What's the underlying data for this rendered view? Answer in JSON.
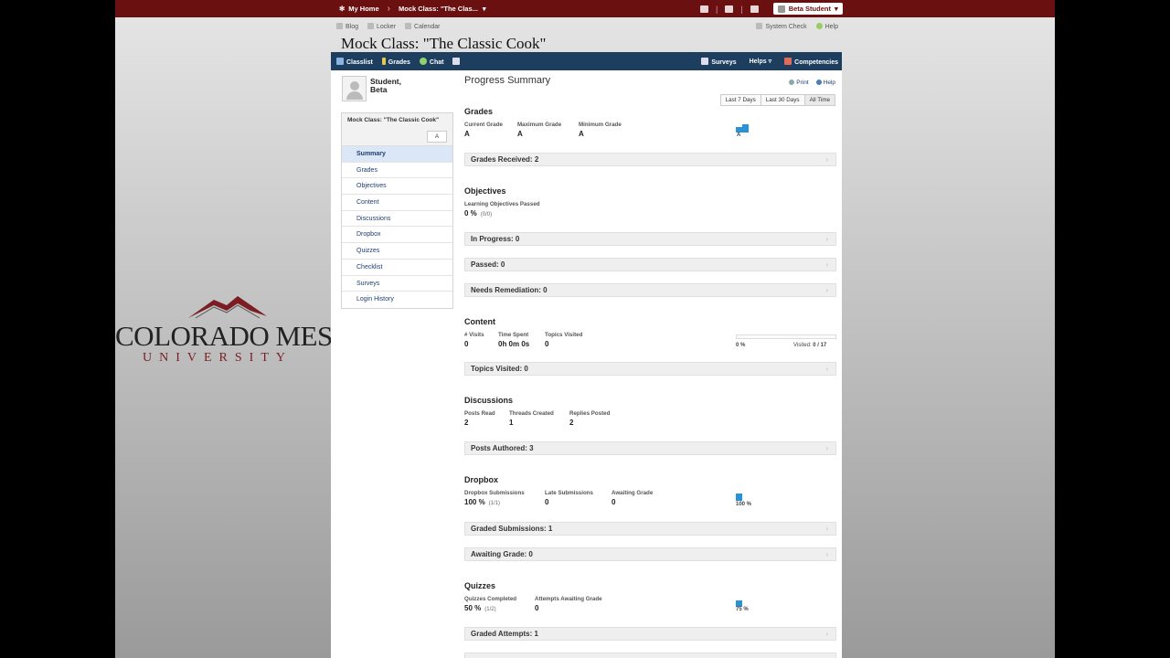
{
  "topbar": {
    "home": "My Home",
    "course": "Mock Class: \"The Clas...",
    "user": "Beta Student"
  },
  "subbar": {
    "left": [
      "Blog",
      "Locker",
      "Calendar"
    ],
    "right": [
      "System Check",
      "Help"
    ]
  },
  "course_title": "Mock Class: \"The Classic Cook\"",
  "navbar": {
    "left": [
      "Classlist",
      "Grades",
      "Chat"
    ],
    "right": [
      "Surveys",
      "Helps",
      "Competencies"
    ]
  },
  "student": {
    "name": "Student,\nBeta"
  },
  "sidebar": {
    "course": "Mock Class: \"The Classic Cook\"",
    "grade": "A",
    "items": [
      "Summary",
      "Grades",
      "Objectives",
      "Content",
      "Discussions",
      "Dropbox",
      "Quizzes",
      "Checklist",
      "Surveys",
      "Login History"
    ]
  },
  "logo": {
    "line1": "COLORADO MES",
    "line2": "UNIVERSITY"
  },
  "main": {
    "title": "Progress Summary",
    "print": "Print",
    "help": "Help",
    "ranges": [
      "Last 7 Days",
      "Last 30 Days",
      "All Time"
    ],
    "grades": {
      "heading": "Grades",
      "stats": [
        {
          "label": "Current Grade",
          "value": "A"
        },
        {
          "label": "Maximum Grade",
          "value": "A"
        },
        {
          "label": "Minimum Grade",
          "value": "A"
        }
      ],
      "chart_label": "A",
      "bar": "Grades Received: 2"
    },
    "objectives": {
      "heading": "Objectives",
      "label": "Learning Objectives Passed",
      "value": "0 %",
      "sub": "(0/0)",
      "bars": [
        "In Progress: 0",
        "Passed: 0",
        "Needs Remediation: 0"
      ]
    },
    "content": {
      "heading": "Content",
      "stats": [
        {
          "label": "# Visits",
          "value": "0"
        },
        {
          "label": "Time Spent",
          "value": "0h 0m 0s"
        },
        {
          "label": "Topics Visited",
          "value": "0"
        }
      ],
      "pct": "0 %",
      "visited_label": "Visited:",
      "visited": "0 / 17",
      "progress": 0,
      "bar": "Topics Visited: 0"
    },
    "discussions": {
      "heading": "Discussions",
      "stats": [
        {
          "label": "Posts Read",
          "value": "2"
        },
        {
          "label": "Threads Created",
          "value": "1"
        },
        {
          "label": "Replies Posted",
          "value": "2"
        }
      ],
      "bar": "Posts Authored: 3"
    },
    "dropbox": {
      "heading": "Dropbox",
      "stats": [
        {
          "label": "Dropbox Submissions",
          "value": "100 %",
          "sub": "(1/1)"
        },
        {
          "label": "Late Submissions",
          "value": "0"
        },
        {
          "label": "Awaiting Grade",
          "value": "0"
        }
      ],
      "chart_label": "100 %",
      "bars": [
        "Graded Submissions: 1",
        "Awaiting Grade: 0"
      ]
    },
    "quizzes": {
      "heading": "Quizzes",
      "stats": [
        {
          "label": "Quizzes Completed",
          "value": "50 %",
          "sub": "(1/2)"
        },
        {
          "label": "Attempts Awaiting Grade",
          "value": "0"
        }
      ],
      "chart_label": "75 %",
      "bars": [
        "Graded Attempts: 1"
      ]
    }
  },
  "colors": {
    "topbar": "#6b1010",
    "navbar": "#1d3e5f",
    "accent": "#2a93d5"
  }
}
